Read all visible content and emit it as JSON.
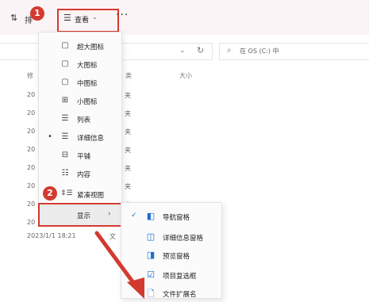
{
  "toolbar": {
    "sort_icon": "⇅",
    "sort_label": "排",
    "view_label": "查看",
    "view_caret": "⌄",
    "more_label": "···"
  },
  "badges": {
    "one": "1",
    "two": "2"
  },
  "address": {
    "chevron": "⌄",
    "refresh": "↻"
  },
  "search": {
    "placeholder": "在 OS (C:) 中"
  },
  "columns": {
    "modified": "修",
    "type": "类",
    "size": "大小"
  },
  "rows": [
    {
      "date": "20",
      "type": "夹"
    },
    {
      "date": "20",
      "type": "夹"
    },
    {
      "date": "20",
      "type": "夹"
    },
    {
      "date": "20",
      "type": "夹"
    },
    {
      "date": "20",
      "type": "夹"
    },
    {
      "date": "20",
      "type": "夹"
    },
    {
      "date": "20",
      "type": "夹"
    },
    {
      "date": "20",
      "type": "夹"
    },
    {
      "date": "20",
      "type": "夹"
    }
  ],
  "view_menu": {
    "items": [
      {
        "label": "超大图标",
        "icon": "▢"
      },
      {
        "label": "大图标",
        "icon": "▢"
      },
      {
        "label": "中图标",
        "icon": "▢"
      },
      {
        "label": "小图标",
        "icon": "⊞"
      },
      {
        "label": "列表",
        "icon": "☰"
      },
      {
        "label": "详细信息",
        "icon": "☰",
        "selected": true
      },
      {
        "label": "平铺",
        "icon": "⊟"
      },
      {
        "label": "内容",
        "icon": "☷"
      },
      {
        "label": "紧凑视图",
        "icon": "⇕☰"
      }
    ],
    "bullet": "•",
    "show_label": "显示",
    "show_arrow": "›"
  },
  "show_submenu": {
    "check": "✓",
    "items": [
      {
        "label": "导航窗格",
        "icon": "◧",
        "checked": true
      },
      {
        "label": "详细信息窗格",
        "icon": "◫"
      },
      {
        "label": "预览窗格",
        "icon": "◨"
      },
      {
        "label": "项目复选框",
        "icon": "☑"
      },
      {
        "label": "文件扩展名",
        "icon": "🗋"
      }
    ]
  },
  "footer": {
    "date": "2023/1/1 18:21",
    "type": "文"
  },
  "colors": {
    "accent_red": "#d33a2f",
    "toolbar_bg": "#fbf4f6",
    "check_blue": "#1a6fd1"
  }
}
